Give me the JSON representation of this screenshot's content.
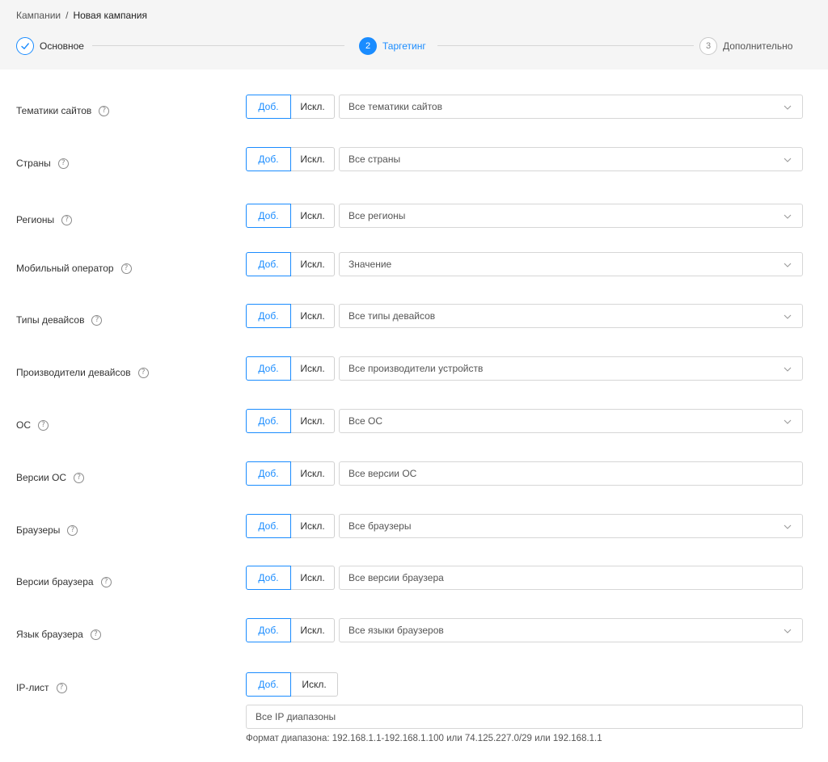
{
  "breadcrumb": {
    "parent": "Кампании",
    "separator": "/",
    "current": "Новая кампания"
  },
  "steps": [
    {
      "number": "1",
      "label": "Основное",
      "state": "done"
    },
    {
      "number": "2",
      "label": "Таргетинг",
      "state": "active"
    },
    {
      "number": "3",
      "label": "Дополнительно",
      "state": "pending"
    }
  ],
  "colors": {
    "accent": "#1a8cff",
    "header_bg": "#f5f5f5",
    "border": "#d6d6d6"
  },
  "toggle": {
    "add_label": "Доб.",
    "exclude_label": "Искл."
  },
  "help_glyph": "?",
  "rows": [
    {
      "label": "Тематики сайтов",
      "value": "Все тематики сайтов",
      "dropdown": true
    },
    {
      "label": "Страны",
      "value": "Все страны",
      "dropdown": true
    },
    {
      "label": "Регионы",
      "value": "Все регионы",
      "dropdown": true
    },
    {
      "label": "Мобильный оператор",
      "value": "Значение",
      "dropdown": true
    },
    {
      "label": "Типы девайсов",
      "value": "Все типы девайсов",
      "dropdown": true
    },
    {
      "label": "Производители девайсов",
      "value": "Все производители устройств",
      "dropdown": true
    },
    {
      "label": "ОС",
      "value": "Все ОС",
      "dropdown": true
    },
    {
      "label": "Версии ОС",
      "value": "Все версии ОС",
      "dropdown": false
    },
    {
      "label": "Браузеры",
      "value": "Все браузеры",
      "dropdown": true
    },
    {
      "label": "Версии браузера",
      "value": "Все версии браузера",
      "dropdown": false
    },
    {
      "label": "Язык браузера",
      "value": "Все языки браузеров",
      "dropdown": true
    }
  ],
  "ip_list": {
    "label": "IP-лист",
    "value": "Все IP диапазоны",
    "hint": "Формат диапазона: 192.168.1.1-192.168.1.100 или 74.125.227.0/29 или 192.168.1.1"
  },
  "icons": {
    "help": "question-circle-icon",
    "dropdown": "chevron-down-icon",
    "done": "check-icon"
  }
}
